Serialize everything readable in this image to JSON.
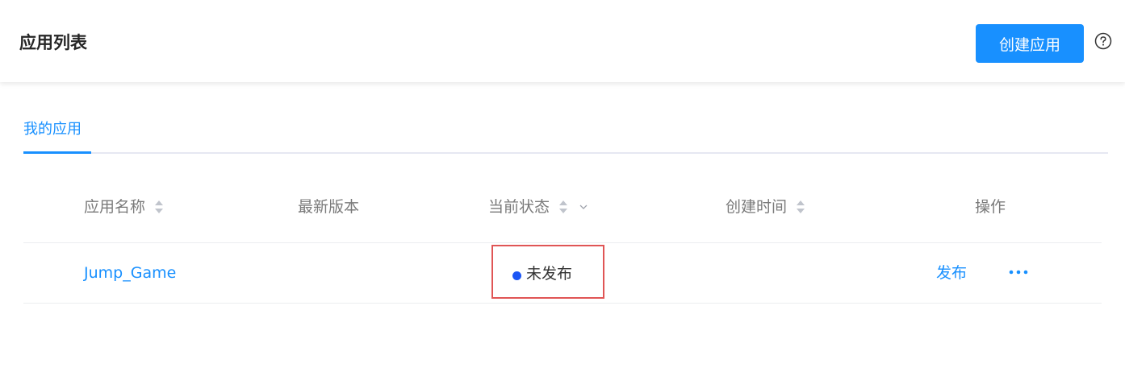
{
  "header": {
    "title": "应用列表",
    "create_button": "创建应用",
    "help_icon": "question-circle-icon"
  },
  "tabs": [
    {
      "label": "我的应用",
      "active": true
    }
  ],
  "table": {
    "columns": [
      {
        "label": "应用名称",
        "sortable": true,
        "filterable": false
      },
      {
        "label": "最新版本",
        "sortable": false,
        "filterable": false
      },
      {
        "label": "当前状态",
        "sortable": true,
        "filterable": true
      },
      {
        "label": "创建时间",
        "sortable": true,
        "filterable": false
      },
      {
        "label": "操作",
        "sortable": false,
        "filterable": false
      }
    ],
    "rows": [
      {
        "name": "Jump_Game",
        "version": "",
        "status": "未发布",
        "created": "",
        "action": "发布",
        "more_icon": "ellipsis-icon"
      }
    ]
  },
  "colors": {
    "primary": "#1890ff",
    "status_dot": "#1b55f5",
    "highlight_border": "#e05555"
  }
}
